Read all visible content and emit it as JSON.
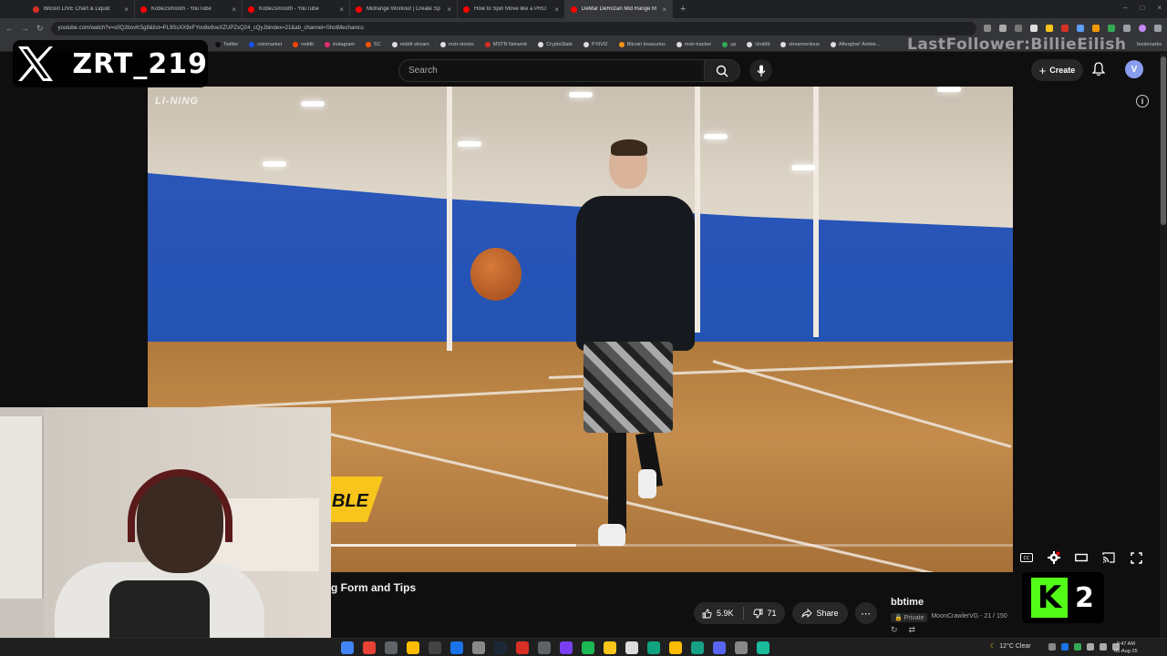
{
  "browser": {
    "tabs": [
      {
        "label": "Bitcoin LIVE Chart & Liquid",
        "color": "#d93025"
      },
      {
        "label": "Kobe2smooth - YouTube",
        "color": "#ff0000"
      },
      {
        "label": "Kobe2smooth - YouTube",
        "color": "#ff0000"
      },
      {
        "label": "Midrange Workout | Create Sp",
        "color": "#ff0000"
      },
      {
        "label": "How to Spin Move like a PRO",
        "color": "#ff0000"
      },
      {
        "label": "DeMar DeRozan Mid Range M",
        "color": "#ff0000",
        "active": true
      }
    ],
    "url": "youtube.com/watch?v=s0Q2bovKSg8&list=PL9SsXX9xFYov8e8veXZUPZxQ24_cQyJbindex=21&ab_channel=ShotMechanics",
    "bookmarks": [
      {
        "label": "Twitter",
        "color": "#111111"
      },
      {
        "label": "coinmarket",
        "color": "#1652f0"
      },
      {
        "label": "reddit",
        "color": "#ff4500"
      },
      {
        "label": "instagram",
        "color": "#e1306c"
      },
      {
        "label": "SC",
        "color": "#ff5500"
      },
      {
        "label": "reddit stream",
        "color": "#dddddd"
      },
      {
        "label": "mstr-stocks",
        "color": "#dddddd"
      },
      {
        "label": "MSTR Network",
        "color": "#d93025"
      },
      {
        "label": "CryptoSlate",
        "color": "#dddddd"
      },
      {
        "label": "P:NVIZ",
        "color": "#dddddd"
      },
      {
        "label": "Bitcoin treasuries",
        "color": "#f7931a"
      },
      {
        "label": "mstr-tracker",
        "color": "#dddddd"
      },
      {
        "label": "up",
        "color": "#34a853"
      },
      {
        "label": "Unddit",
        "color": "#dddddd"
      },
      {
        "label": "streamerdous",
        "color": "#dddddd"
      },
      {
        "label": "Afterglow' Ambie...",
        "color": "#dddddd"
      }
    ],
    "bookmarks_right": "bookmarks"
  },
  "youtube": {
    "search_placeholder": "Search",
    "create_label": "Create",
    "avatar_letter": "V",
    "video_title": "g Form and Tips",
    "likes": "5.9K",
    "dislikes": "71",
    "share_label": "Share",
    "playlist": {
      "title": "bbtime",
      "privacy": "Private",
      "meta": "MoonCrawlerVG - 21 / 150"
    }
  },
  "video": {
    "brand_logo": "LI-NING",
    "banner_text": "BLE",
    "progress": 0.36
  },
  "overlays": {
    "x_handle": "ZRT_219",
    "last_follower": "LastFollower:BillieEilish",
    "kick_number": "2",
    "kick_letter": "K"
  },
  "taskbar": {
    "weather": "12°C Clear",
    "time": "9:47 AM",
    "date": "05-Aug-25",
    "apps": [
      "#4285f4",
      "#ea4335",
      "#5f6368",
      "#fbbc04",
      "#444444",
      "#1a73e8",
      "#888888",
      "#1b2838",
      "#d93025",
      "#5f6368",
      "#7b3ff2",
      "#1db954",
      "#f7c51b",
      "#dddddd",
      "#10a37f",
      "#fbbc04",
      "#16a085",
      "#5865f2",
      "#888888",
      "#1abc9c"
    ]
  }
}
